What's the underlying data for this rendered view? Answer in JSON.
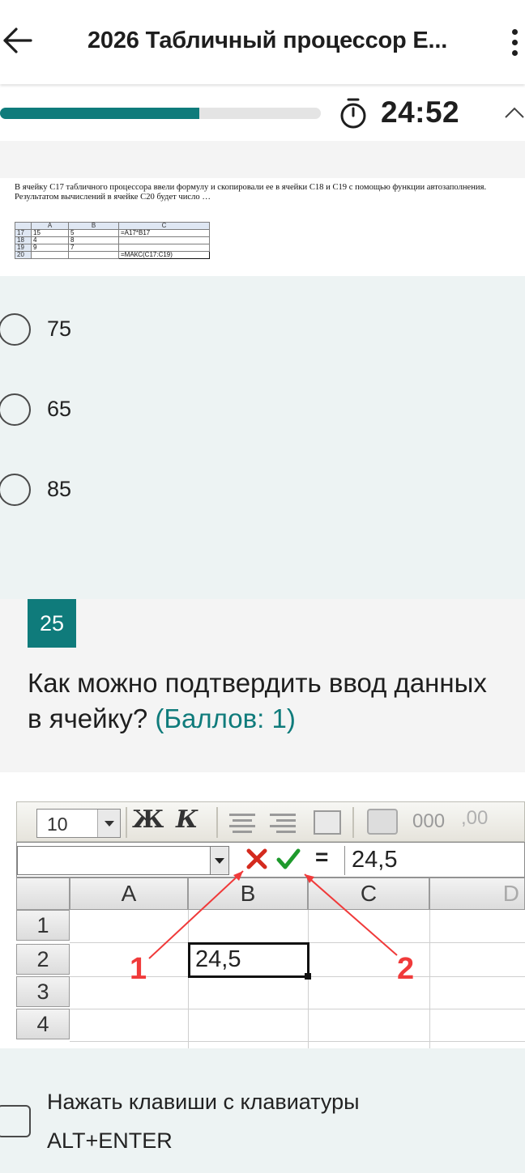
{
  "header": {
    "title": "2026 Табличный процессор  Е...",
    "back_icon": "arrow-left-icon",
    "more_icon": "more-vertical-icon"
  },
  "progress": {
    "fraction": 0.62,
    "timer": "24:52",
    "accent_color": "#0f7b7b"
  },
  "prev_question": {
    "text_line1": "В ячейку С17 табличного процессора ввели формулу и скопировали ее в ячейки С18 и С19 с помощью функции автозаполнения.",
    "text_line2": "Результатом вычислений в ячейке С20 будет число …",
    "sheet": {
      "col_headers": [
        "A",
        "B",
        "C"
      ],
      "rows": [
        {
          "n": "17",
          "a": "15",
          "b": "5",
          "c": "=A17*B17"
        },
        {
          "n": "18",
          "a": "4",
          "b": "8",
          "c": ""
        },
        {
          "n": "19",
          "a": "9",
          "b": "7",
          "c": ""
        },
        {
          "n": "20",
          "a": "",
          "b": "",
          "c": "=МАКС(C17:C19)"
        }
      ]
    },
    "options": [
      "75",
      "65",
      "85"
    ]
  },
  "question": {
    "number": "25",
    "text": "Как можно подтвердить ввод данных в ячейку?",
    "points": "(Баллов: 1)"
  },
  "excel_image": {
    "font_size": "10",
    "bold_label": "Ж",
    "italic_label": "К",
    "thousands_label": "000",
    "decimals_label": ",00",
    "formula_value": "24,5",
    "equals": "=",
    "col_headers": [
      "A",
      "B",
      "C",
      "D"
    ],
    "row_headers": [
      "1",
      "2",
      "3",
      "4"
    ],
    "active_cell_value": "24,5",
    "callout_1": "1",
    "callout_2": "2"
  },
  "answer_option": {
    "line1": "Нажать клавиши с клавиатуры",
    "line2": "ALT+ENTER"
  }
}
